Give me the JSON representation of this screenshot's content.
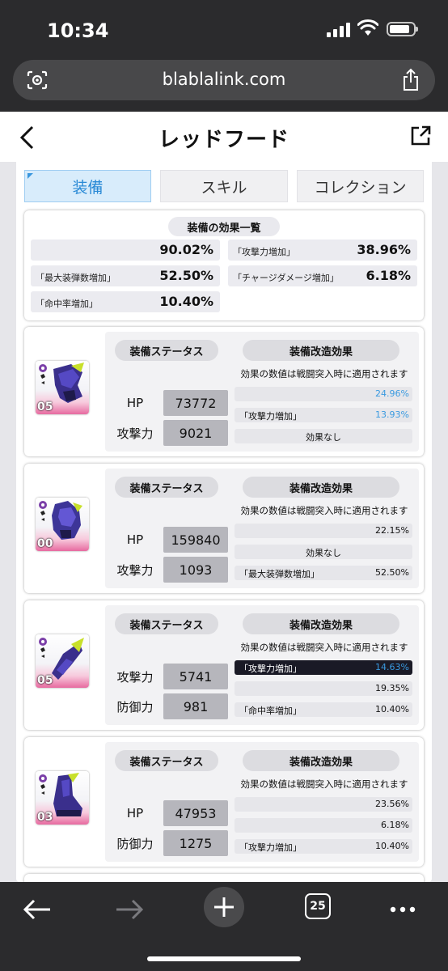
{
  "status_bar": {
    "time": "10:34"
  },
  "browser": {
    "url": "blablalink.com",
    "tab_count": "25"
  },
  "header": {
    "title": "レッドフード"
  },
  "tabs": [
    {
      "label": "装備",
      "active": true
    },
    {
      "label": "スキル",
      "active": false
    },
    {
      "label": "コレクション",
      "active": false
    }
  ],
  "summary": {
    "title": "装備の効果一覧",
    "items": [
      {
        "label": "",
        "value": "90.02%"
      },
      {
        "label": "「攻撃力増加」",
        "value": "38.96%"
      },
      {
        "label": "「最大装弾数増加」",
        "value": "52.50%"
      },
      {
        "label": "「チャージダメージ増加」",
        "value": "6.18%"
      },
      {
        "label": "「命中率増加」",
        "value": "10.40%"
      }
    ]
  },
  "equipment": [
    {
      "level": "05",
      "status_header": "装備ステータス",
      "effect_header": "装備改造効果",
      "stats": [
        {
          "label": "HP",
          "value": "73772"
        },
        {
          "label": "攻撃力",
          "value": "9021"
        }
      ],
      "note": "効果の数値は戦闘突入時に適用されます",
      "effects": [
        {
          "label": "",
          "value": "24.96%",
          "style": "blue"
        },
        {
          "label": "「攻撃力増加」",
          "value": "13.93%",
          "style": "blue"
        },
        {
          "label": "効果なし",
          "value": "",
          "style": "center"
        }
      ]
    },
    {
      "level": "00",
      "status_header": "装備ステータス",
      "effect_header": "装備改造効果",
      "stats": [
        {
          "label": "HP",
          "value": "159840"
        },
        {
          "label": "攻撃力",
          "value": "1093"
        }
      ],
      "note": "効果の数値は戦闘突入時に適用されます",
      "effects": [
        {
          "label": "",
          "value": "22.15%",
          "style": "normal"
        },
        {
          "label": "効果なし",
          "value": "",
          "style": "center"
        },
        {
          "label": "「最大装弾数増加」",
          "value": "52.50%",
          "style": "normal"
        }
      ]
    },
    {
      "level": "05",
      "status_header": "装備ステータス",
      "effect_header": "装備改造効果",
      "stats": [
        {
          "label": "攻撃力",
          "value": "5741"
        },
        {
          "label": "防御力",
          "value": "981"
        }
      ],
      "note": "効果の数値は戦闘突入時に適用されます",
      "effects": [
        {
          "label": "「攻撃力増加」",
          "value": "14.63%",
          "style": "dark"
        },
        {
          "label": "",
          "value": "19.35%",
          "style": "normal"
        },
        {
          "label": "「命中率増加」",
          "value": "10.40%",
          "style": "normal"
        }
      ]
    },
    {
      "level": "03",
      "status_header": "装備ステータス",
      "effect_header": "装備改造効果",
      "stats": [
        {
          "label": "HP",
          "value": "47953"
        },
        {
          "label": "防御力",
          "value": "1275"
        }
      ],
      "note": "効果の数値は戦闘突入時に適用されます",
      "effects": [
        {
          "label": "",
          "value": "23.56%",
          "style": "normal"
        },
        {
          "label": "",
          "value": "6.18%",
          "style": "normal"
        },
        {
          "label": "「攻撃力増加」",
          "value": "10.40%",
          "style": "normal"
        }
      ]
    }
  ],
  "colors": {
    "accent_blue": "#3a9ae0",
    "tab_active_bg": "#d8ecfb",
    "chrome": "#2b2b2d",
    "rarity_pink": "#e76aa0"
  },
  "icons": [
    "lens-icon",
    "share-icon",
    "back-icon",
    "external-link-icon",
    "arrow-left-icon",
    "arrow-right-icon",
    "plus-icon",
    "tabs-icon",
    "more-icon"
  ]
}
